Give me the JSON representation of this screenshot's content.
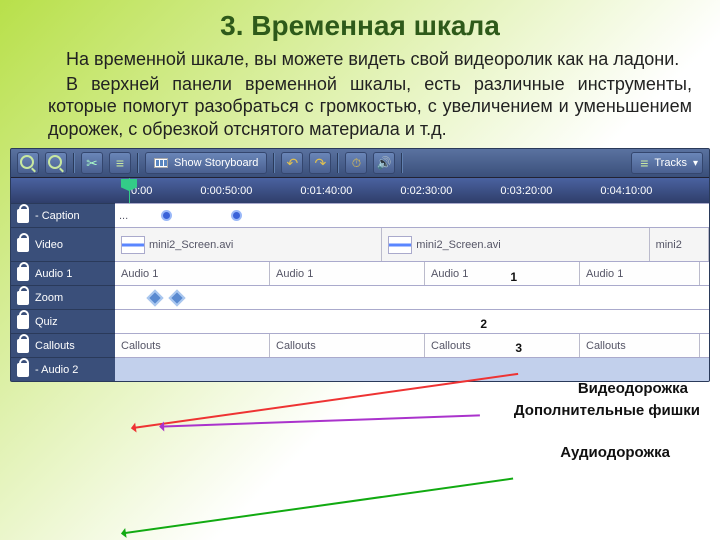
{
  "title": "3. Временная шкала",
  "paragraphs": [
    "На временной шкале, вы можете видеть свой видеоролик как на ладони.",
    "В верхней панели временной шкалы, есть различные инструменты, которые помогут разобраться с громкостью, с увеличением и уменьшением дорожек, с обрезкой отснятого материала и т.д."
  ],
  "toolbar": {
    "show_storyboard": "Show Storyboard",
    "tracks": "Tracks"
  },
  "ruler": {
    "times": [
      "0:00",
      "0:00:50:00",
      "0:01:40:00",
      "0:02:30:00",
      "0:03:20:00",
      "0:04:10:00"
    ]
  },
  "rows": {
    "caption": {
      "label": "- Caption",
      "state": "..."
    },
    "video": {
      "label": "Video",
      "clip1": "mini2_Screen.avi",
      "clip2": "mini2_Screen.avi",
      "clip3": "mini2"
    },
    "audio1": {
      "label": "Audio 1",
      "c": "Audio 1"
    },
    "zoom": {
      "label": "Zoom"
    },
    "quiz": {
      "label": "Quiz"
    },
    "callouts": {
      "label": "Callouts",
      "c": "Callouts"
    },
    "audio2": {
      "label": "- Audio 2"
    }
  },
  "annotations": {
    "n1": "1",
    "n2": "2",
    "n3": "3",
    "a1": "Видеодорожка",
    "a2": "Дополнительные фишки",
    "a3": "Аудиодорожка"
  }
}
